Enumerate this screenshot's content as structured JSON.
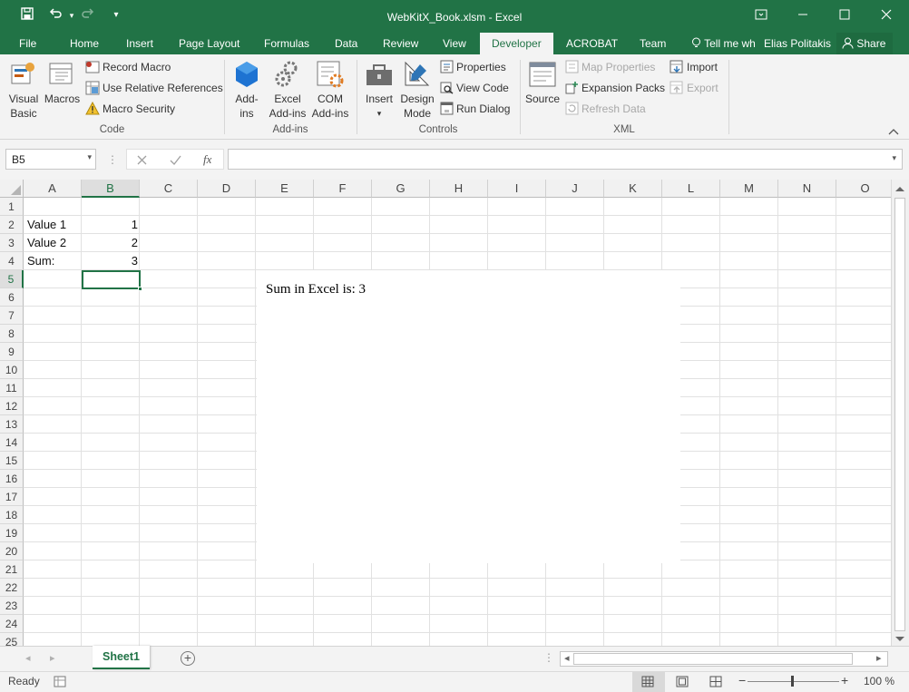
{
  "window": {
    "title": "WebKitX_Book.xlsm - Excel"
  },
  "tabs": [
    {
      "label": "File"
    },
    {
      "label": "Home"
    },
    {
      "label": "Insert"
    },
    {
      "label": "Page Layout"
    },
    {
      "label": "Formulas"
    },
    {
      "label": "Data"
    },
    {
      "label": "Review"
    },
    {
      "label": "View"
    },
    {
      "label": "Developer",
      "active": true
    },
    {
      "label": "ACROBAT"
    },
    {
      "label": "Team"
    }
  ],
  "tell_me": "Tell me wh",
  "user": "Elias Politakis",
  "share": "Share",
  "ribbon": {
    "code": {
      "group": "Code",
      "visual_basic_1": "Visual",
      "visual_basic_2": "Basic",
      "macros": "Macros",
      "record_macro": "Record Macro",
      "use_relative": "Use Relative References",
      "macro_security": "Macro Security"
    },
    "addins": {
      "group": "Add-ins",
      "addins_1": "Add-",
      "addins_2": "ins",
      "excel_addins_1": "Excel",
      "excel_addins_2": "Add-ins",
      "com_addins_1": "COM",
      "com_addins_2": "Add-ins"
    },
    "controls": {
      "group": "Controls",
      "insert": "Insert",
      "design_1": "Design",
      "design_2": "Mode",
      "properties": "Properties",
      "view_code": "View Code",
      "run_dialog": "Run Dialog"
    },
    "xml": {
      "group": "XML",
      "source": "Source",
      "map_properties": "Map Properties",
      "expansion_packs": "Expansion Packs",
      "refresh_data": "Refresh Data",
      "import": "Import",
      "export": "Export"
    }
  },
  "formula_bar": {
    "name_box": "B5",
    "fx": "fx",
    "formula": ""
  },
  "columns": [
    "A",
    "B",
    "C",
    "D",
    "E",
    "F",
    "G",
    "H",
    "I",
    "J",
    "K",
    "L",
    "M",
    "N",
    "O"
  ],
  "rows": [
    "1",
    "2",
    "3",
    "4",
    "5",
    "6",
    "7",
    "8",
    "9",
    "10",
    "11",
    "12",
    "13",
    "14",
    "15",
    "16",
    "17",
    "18",
    "19",
    "20",
    "21",
    "22",
    "23",
    "24",
    "25"
  ],
  "cells": {
    "a2": "Value 1",
    "b2": "1",
    "a3": "Value 2",
    "b3": "2",
    "a4": "Sum:",
    "b4": "3"
  },
  "browser_control": {
    "text": "Sum in Excel is: 3"
  },
  "sheet_tab": "Sheet1",
  "status": {
    "ready": "Ready",
    "zoom": "100 %"
  },
  "colors": {
    "accent": "#217346",
    "ribbon_bg": "#f3f3f3"
  }
}
